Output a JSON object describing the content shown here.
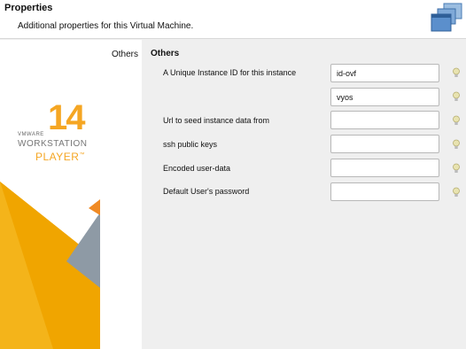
{
  "header": {
    "title": "Properties",
    "subtitle": "Additional properties for this Virtual Machine."
  },
  "branding": {
    "vendor": "VMWARE",
    "version": "14",
    "product_line1": "WORKSTATION",
    "product_line2": "PLAYER",
    "trademark": "™",
    "accent_color": "#f5a623"
  },
  "tabs": [
    {
      "label": "Others"
    }
  ],
  "section": {
    "title": "Others",
    "rows": [
      {
        "label": "A Unique Instance ID for this instance",
        "value": "id-ovf",
        "placeholder": ""
      },
      {
        "label": "",
        "value": "vyos",
        "placeholder": ""
      },
      {
        "label": "Url to seed instance data from",
        "value": "",
        "placeholder": ""
      },
      {
        "label": "ssh public keys",
        "value": "",
        "placeholder": ""
      },
      {
        "label": "Encoded user-data",
        "value": "",
        "placeholder": ""
      },
      {
        "label": "Default User's password",
        "value": "",
        "placeholder": ""
      }
    ]
  },
  "icons": {
    "header": "window-stack-icon",
    "hint": "lightbulb-icon"
  }
}
